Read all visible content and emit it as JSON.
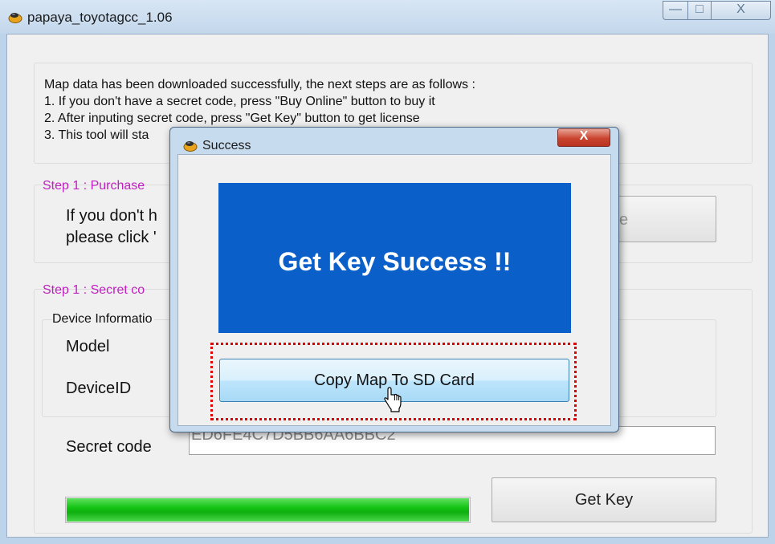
{
  "window": {
    "title": "papaya_toyotagcc_1.06",
    "minimize_glyph": "—",
    "maximize_glyph": "□",
    "close_glyph": "X"
  },
  "intro": {
    "line1": "Map data has been downloaded successfully, the next steps are as follows :",
    "line2": "1. If you don't have a secret code, press \"Buy Online\" button to buy it",
    "line3": "2. After inputing secret code, press \"Get Key\" button to get license",
    "line4": "3. This tool will sta"
  },
  "purchase": {
    "label": "Step 1 : Purchase",
    "line1": "If you don't h",
    "line2": "please click '",
    "buy_button": "line"
  },
  "secret": {
    "label": "Step 1 : Secret co",
    "device_group": "Device Informatio",
    "model_label": "Model",
    "deviceid_label": "DeviceID",
    "secret_label": "Secret code",
    "secret_value": "ED6FE4C7D5BB6AA6BBC2",
    "get_key_button": "Get Key",
    "progress_fraction": 1.0
  },
  "dialog": {
    "title": "Success",
    "close_glyph": "X",
    "message": "Get Key Success !!",
    "copy_button": "Copy Map To SD Card"
  },
  "colors": {
    "dialog_panel": "#0a60c8",
    "step_label": "#c020c0",
    "progress": "#14c414",
    "highlight": "#e00000"
  },
  "icons": [
    "app-icon",
    "dialog-icon",
    "hand-cursor-icon"
  ]
}
